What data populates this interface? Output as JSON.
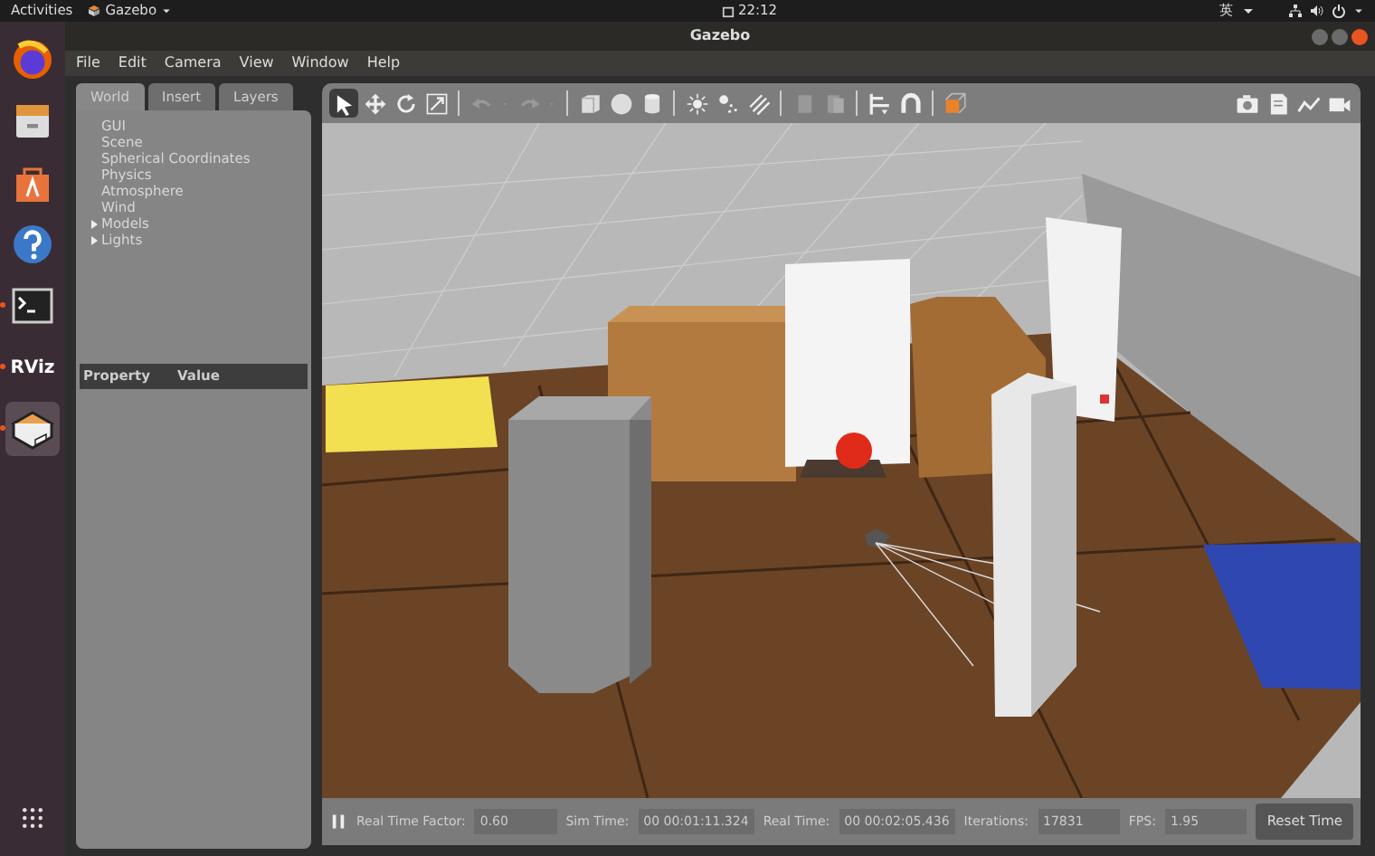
{
  "top_bar": {
    "activities": "Activities",
    "app_menu": "Gazebo",
    "clock": "22:12",
    "input_method": "英"
  },
  "dock": [
    {
      "kind": "firefox",
      "running": false,
      "selected": false
    },
    {
      "kind": "files",
      "running": false,
      "selected": false
    },
    {
      "kind": "software",
      "running": false,
      "selected": false
    },
    {
      "kind": "help",
      "running": false,
      "selected": false
    },
    {
      "kind": "terminal",
      "running": true,
      "selected": false
    },
    {
      "kind": "rviz",
      "label": "RViz",
      "running": true,
      "selected": false
    },
    {
      "kind": "gazebo",
      "running": true,
      "selected": true
    },
    {
      "kind": "apps",
      "running": false,
      "selected": false
    }
  ],
  "window": {
    "title": "Gazebo"
  },
  "menu": [
    "File",
    "Edit",
    "Camera",
    "View",
    "Window",
    "Help"
  ],
  "tabs": [
    {
      "label": "World",
      "selected": true
    },
    {
      "label": "Insert",
      "selected": false
    },
    {
      "label": "Layers",
      "selected": false
    }
  ],
  "tree": [
    {
      "label": "GUI",
      "kind": "leaf"
    },
    {
      "label": "Scene",
      "kind": "leaf"
    },
    {
      "label": "Spherical Coordinates",
      "kind": "leaf"
    },
    {
      "label": "Physics",
      "kind": "leaf"
    },
    {
      "label": "Atmosphere",
      "kind": "leaf"
    },
    {
      "label": "Wind",
      "kind": "leaf"
    },
    {
      "label": "Models",
      "kind": "group",
      "expanded": false
    },
    {
      "label": "Lights",
      "kind": "group",
      "expanded": false
    }
  ],
  "properties": {
    "columns": [
      "Property",
      "Value"
    ]
  },
  "toolbar": {
    "groups": [
      [
        {
          "kind": "select",
          "selected": true
        },
        {
          "kind": "translate",
          "selected": false
        },
        {
          "kind": "rotate",
          "selected": false
        },
        {
          "kind": "scale",
          "selected": false
        }
      ],
      [
        {
          "kind": "undo",
          "selected": false
        },
        {
          "kind": "caret",
          "selected": false
        },
        {
          "kind": "redo",
          "selected": false
        },
        {
          "kind": "caret",
          "selected": false
        }
      ],
      [
        {
          "kind": "box",
          "selected": false
        },
        {
          "kind": "sphere",
          "selected": false
        },
        {
          "kind": "cylinder",
          "selected": false
        }
      ],
      [
        {
          "kind": "sun",
          "selected": false
        },
        {
          "kind": "pointlight",
          "selected": false
        },
        {
          "kind": "spotlight",
          "selected": false
        }
      ],
      [
        {
          "kind": "copy",
          "selected": false
        },
        {
          "kind": "paste",
          "selected": false
        }
      ],
      [
        {
          "kind": "align",
          "selected": false
        },
        {
          "kind": "magnet",
          "selected": false
        }
      ],
      [
        {
          "kind": "view",
          "selected": false
        }
      ]
    ],
    "right": [
      {
        "kind": "camera",
        "selected": false
      },
      {
        "kind": "log",
        "selected": false
      },
      {
        "kind": "plot",
        "selected": false
      },
      {
        "kind": "video",
        "selected": false
      }
    ]
  },
  "status_bar": {
    "paused": false,
    "fields": [
      {
        "label": "Real Time Factor:",
        "value": "0.60"
      },
      {
        "label": "Sim Time:",
        "value": "00 00:01:11.324"
      },
      {
        "label": "Real Time:",
        "value": "00 00:02:05.436"
      },
      {
        "label": "Iterations:",
        "value": "17831"
      },
      {
        "label": "FPS:",
        "value": "1.95"
      }
    ],
    "reset": "Reset Time"
  }
}
